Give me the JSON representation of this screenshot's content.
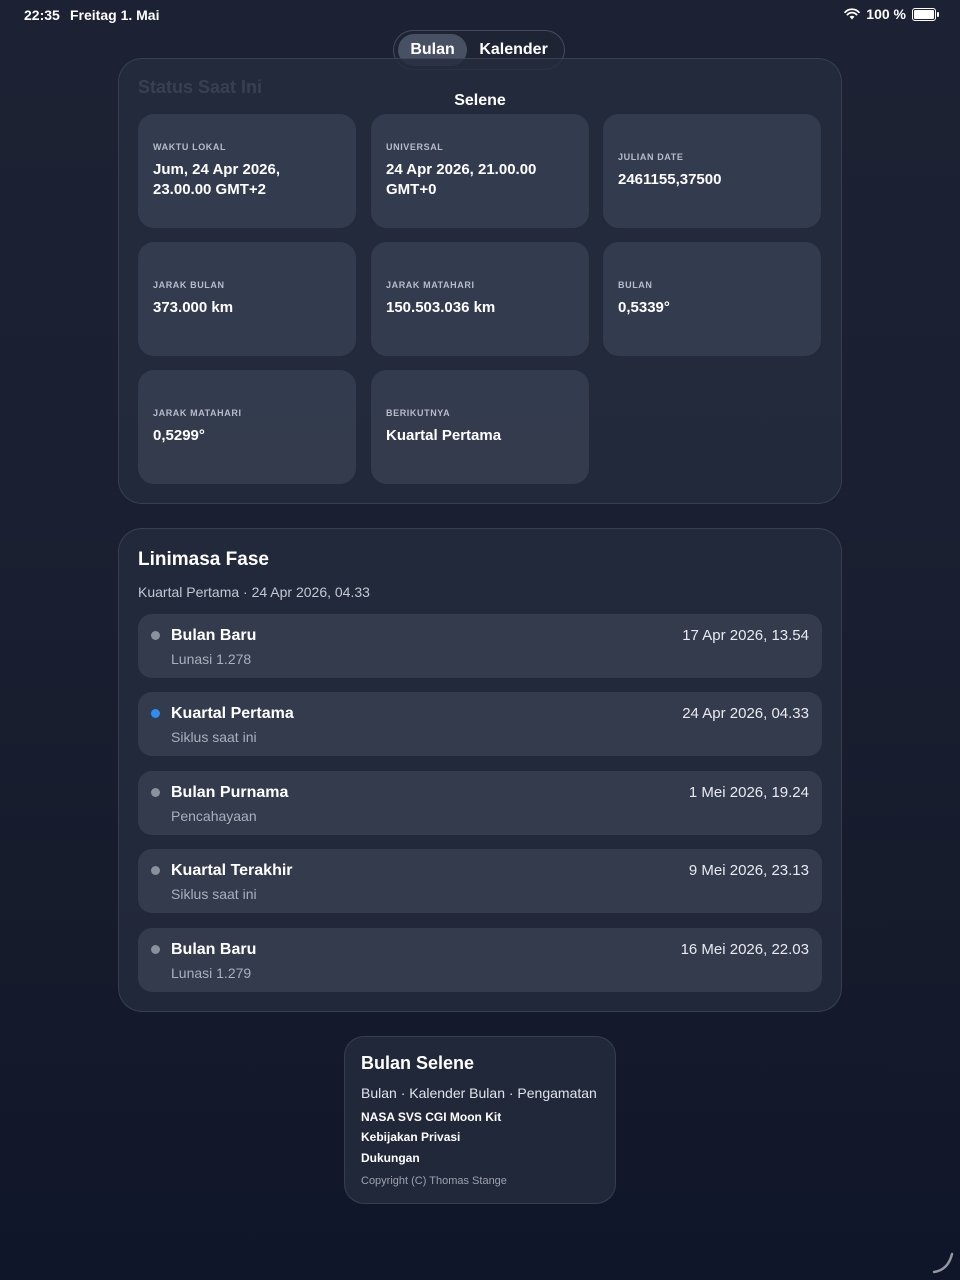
{
  "status_bar": {
    "time": "22:35",
    "date": "Freitag 1. Mai",
    "battery": "100 %"
  },
  "segmented": {
    "options": [
      "Bulan",
      "Kalender"
    ],
    "selected": "Bulan"
  },
  "nav": {
    "title": "Selene"
  },
  "status": {
    "section_title": "Status Saat Ini",
    "tiles": [
      {
        "label": "WAKTU LOKAL",
        "value": "Jum, 24 Apr 2026, 23.00.00 GMT+2"
      },
      {
        "label": "UNIVERSAL",
        "value": "24 Apr 2026, 21.00.00 GMT+0"
      },
      {
        "label": "JULIAN DATE",
        "value": "2461155,37500"
      },
      {
        "label": "JARAK BULAN",
        "value": "373.000 km"
      },
      {
        "label": "JARAK MATAHARI",
        "value": "150.503.036 km"
      },
      {
        "label": "BULAN",
        "value": "0,5339°"
      },
      {
        "label": "JARAK MATAHARI",
        "value": "0,5299°"
      },
      {
        "label": "BERIKUTNYA",
        "value": "Kuartal Pertama"
      }
    ]
  },
  "timeline": {
    "title": "Linimasa Fase",
    "subtitle": "Kuartal Pertama · 24 Apr 2026, 04.33",
    "items": [
      {
        "name": "Bulan Baru",
        "detail": "Lunasi 1.278",
        "date": "17 Apr 2026, 13.54",
        "current": false
      },
      {
        "name": "Kuartal Pertama",
        "detail": "Siklus saat ini",
        "date": "24 Apr 2026, 04.33",
        "current": true
      },
      {
        "name": "Bulan Purnama",
        "detail": "Pencahayaan",
        "date": "1 Mei 2026, 19.24",
        "current": false
      },
      {
        "name": "Kuartal Terakhir",
        "detail": "Siklus saat ini",
        "date": "9 Mei 2026, 23.13",
        "current": false
      },
      {
        "name": "Bulan Baru",
        "detail": "Lunasi 1.279",
        "date": "16 Mei 2026, 22.03",
        "current": false
      }
    ]
  },
  "footer": {
    "title": "Bulan Selene",
    "subtitle": "Bulan · Kalender Bulan · Pengamatan",
    "links": [
      "NASA SVS CGI Moon Kit",
      "Kebijakan Privasi",
      "Dukungan"
    ],
    "copyright": "Copyright (C) Thomas Stange"
  },
  "colors": {
    "accent": "#2f8cf0",
    "background": "#1a2031",
    "card": "#242c3e"
  }
}
